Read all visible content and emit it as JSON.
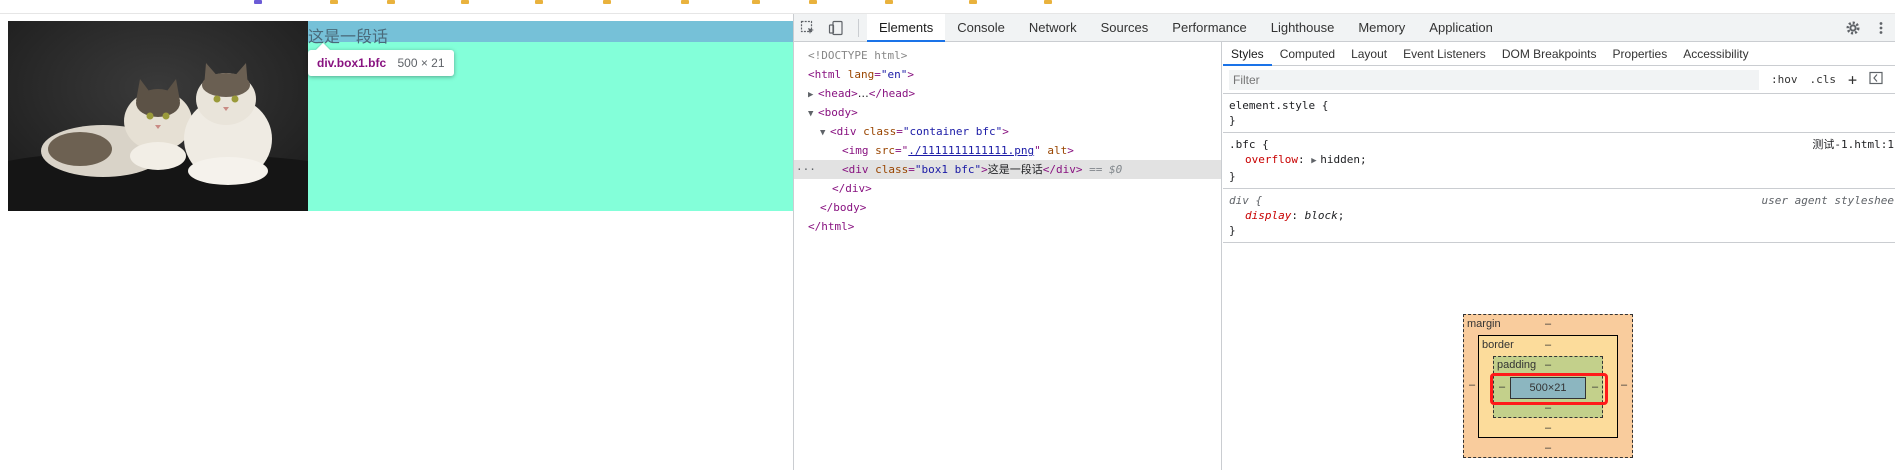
{
  "page": {
    "box_text": "这是一段话",
    "tooltip": {
      "tag": "div.box1.bfc",
      "size": "500 × 21"
    }
  },
  "devtools": {
    "panel_tabs": [
      "Elements",
      "Console",
      "Network",
      "Sources",
      "Performance",
      "Lighthouse",
      "Memory",
      "Application"
    ],
    "active_panel": "Elements",
    "dom": {
      "doctype": "<!DOCTYPE html>",
      "html_open_tag": "html",
      "html_attr": "lang",
      "html_attr_val": "\"en\"",
      "head_tag": "head",
      "head_ellipsis": "…",
      "body_tag": "body",
      "div_tag": "div",
      "class_attr": "class",
      "container_class": "\"container bfc\"",
      "img_tag": "img",
      "src_attr": "src",
      "img_src": "./1111111111111.png",
      "alt_attr": "alt",
      "box_class": "\"box1 bfc\"",
      "box_text": "这是一段话",
      "selected_marker": "== $0",
      "dots": "···"
    },
    "styles": {
      "sub_tabs": [
        "Styles",
        "Computed",
        "Layout",
        "Event Listeners",
        "DOM Breakpoints",
        "Properties",
        "Accessibility"
      ],
      "active_sub_tab": "Styles",
      "filter_placeholder": "Filter",
      "hov_label": ":hov",
      "cls_label": ".cls",
      "plus_label": "+",
      "rules": {
        "element_style": {
          "selector": "element.style {",
          "close": "}"
        },
        "bfc": {
          "selector": ".bfc {",
          "source": "测试-1.html:1",
          "prop": "overflow",
          "value": "hidden",
          "close": "}"
        },
        "div": {
          "selector": "div {",
          "source": "user agent styleshee",
          "prop": "display",
          "value": "block",
          "close": "}"
        }
      },
      "box_model": {
        "margin_label": "margin",
        "border_label": "border",
        "padding_label": "padding",
        "content": "500×21",
        "dash": "–"
      }
    }
  },
  "colors": {
    "box_bg": "#83ffd9",
    "highlight": "#76c1d8",
    "accent": "#1a73e8",
    "red_outline": "#ff1a1a"
  }
}
